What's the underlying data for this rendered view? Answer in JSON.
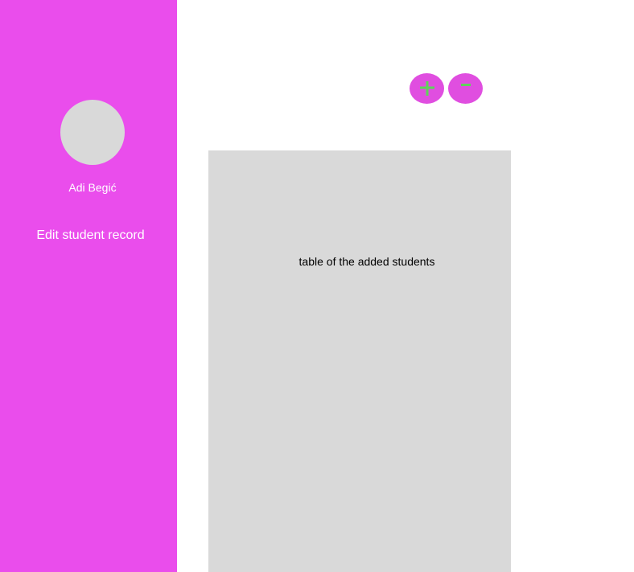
{
  "sidebar": {
    "user_name": "Adi Begić",
    "edit_record_label": "Edit student record"
  },
  "toolbar": {
    "add_symbol": "+",
    "remove_symbol": "−"
  },
  "main": {
    "table_placeholder": "table of the added students"
  },
  "colors": {
    "sidebar_bg": "#ea4dec",
    "button_bg": "#e04ee0",
    "button_glyph": "#5fd35a",
    "placeholder_gray": "#d9d9d9"
  },
  "icons": {
    "add": "plus-icon",
    "remove": "minus-icon"
  }
}
